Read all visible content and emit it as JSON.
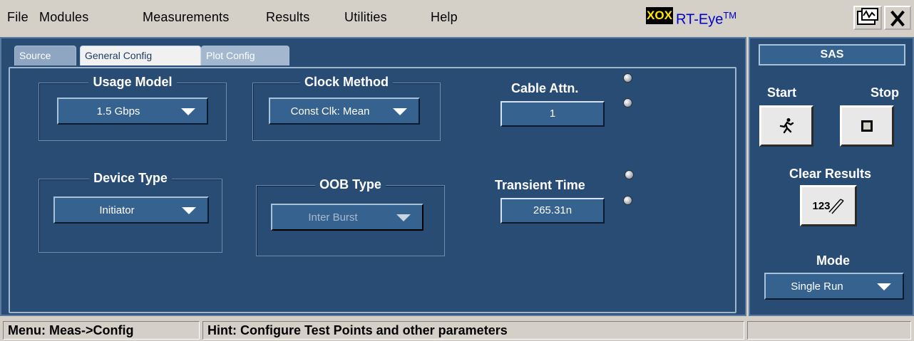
{
  "menubar": {
    "items": [
      "File",
      "Modules",
      "Measurements",
      "Results",
      "Utilities",
      "Help"
    ],
    "logo_text": "XOX",
    "app_name": "RT-Eye",
    "app_tm": "TM"
  },
  "tabs": [
    {
      "label": "Source",
      "active": false
    },
    {
      "label": "General Config",
      "active": true
    },
    {
      "label": "Plot Config",
      "active": false
    }
  ],
  "config": {
    "usage_model": {
      "title": "Usage Model",
      "value": "1.5 Gbps"
    },
    "clock_method": {
      "title": "Clock Method",
      "value": "Const Clk: Mean"
    },
    "device_type": {
      "title": "Device Type",
      "value": "Initiator"
    },
    "oob_type": {
      "title": "OOB Type",
      "value": "Inter Burst",
      "enabled": false
    },
    "cable_attn": {
      "label": "Cable Attn.",
      "value": "1"
    },
    "transient_time": {
      "label": "Transient Time",
      "value": "265.31n"
    }
  },
  "right_panel": {
    "header": "SAS",
    "start_label": "Start",
    "stop_label": "Stop",
    "clear_label": "Clear Results",
    "clear_icon_text": "123",
    "mode_label": "Mode",
    "mode_value": "Single Run"
  },
  "statusbar": {
    "menu_text": "Menu: Meas->Config",
    "hint_text": "Hint: Configure Test Points and other parameters"
  },
  "colors": {
    "panel_bg": "#294c75",
    "control_bg": "#36628f",
    "chrome": "#d4d0c8"
  }
}
